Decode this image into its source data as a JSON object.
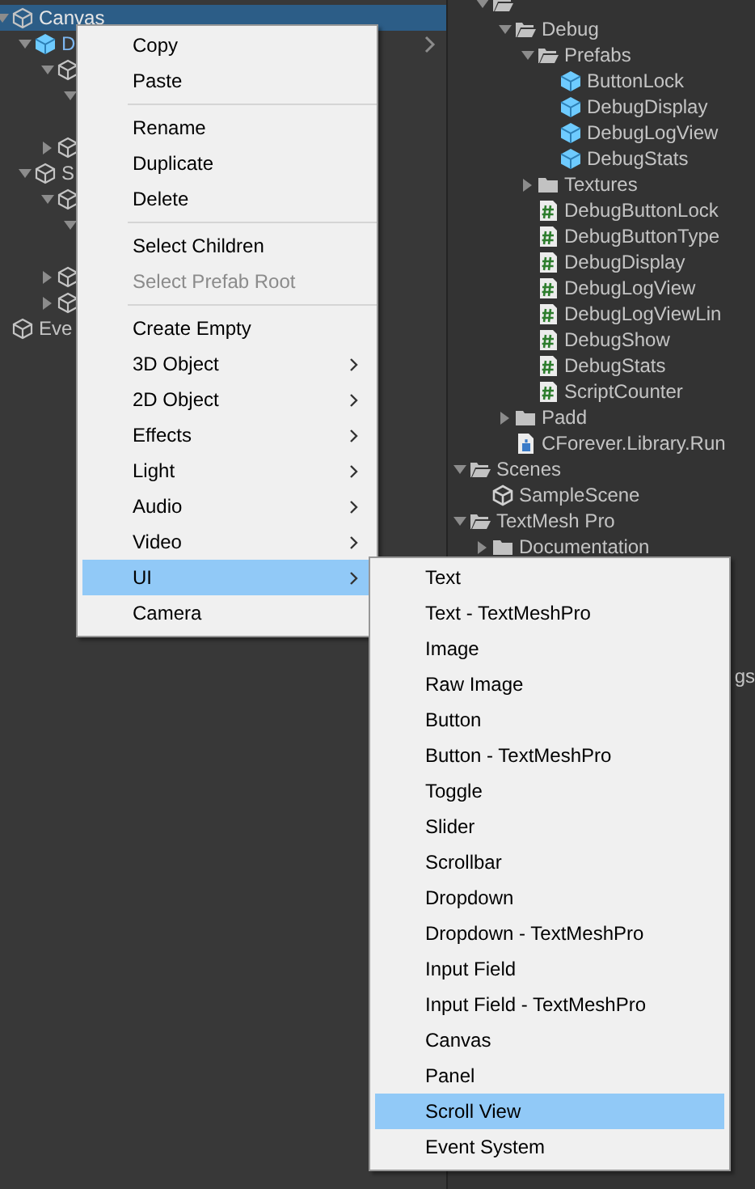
{
  "hierarchy": [
    {
      "label": "Canvas",
      "kind": "gameobject",
      "expanded": true,
      "selected": true,
      "children": [
        {
          "label": "D",
          "kind": "prefab",
          "expanded": true,
          "selected": false,
          "prefab_arrow": true,
          "children": [
            {
              "kind": "gameobject",
              "expanded": true,
              "selected": false,
              "children": [
                {
                  "expanded": true,
                  "selected": false
                }
              ]
            },
            {
              "kind": "gameobject",
              "expanded": false,
              "selected": false
            }
          ]
        },
        {
          "label": "S",
          "kind": "gameobject",
          "expanded": true,
          "selected": false,
          "children": [
            {
              "kind": "gameobject",
              "expanded": true,
              "selected": false,
              "children": [
                {
                  "expanded": true,
                  "selected": false
                }
              ]
            },
            {
              "kind": "gameobject",
              "expanded": false,
              "selected": false
            },
            {
              "kind": "gameobject",
              "expanded": false,
              "selected": false
            }
          ]
        }
      ]
    },
    {
      "label": "Eve",
      "kind": "gameobject",
      "selected": false
    }
  ],
  "project_tree": [
    {
      "kind": "partial",
      "children": [
        {
          "kind": "folder",
          "expanded": true,
          "children": [
            {
              "label": "Debug",
              "kind": "folder",
              "expanded": true,
              "children": [
                {
                  "label": "Prefabs",
                  "kind": "folder",
                  "expanded": true,
                  "children": [
                    {
                      "label": "ButtonLock",
                      "kind": "prefab"
                    },
                    {
                      "label": "DebugDisplay",
                      "kind": "prefab"
                    },
                    {
                      "label": "DebugLogView",
                      "kind": "prefab"
                    },
                    {
                      "label": "DebugStats",
                      "kind": "prefab"
                    }
                  ]
                },
                {
                  "label": "Textures",
                  "kind": "folder",
                  "expanded": false
                },
                {
                  "label": "DebugButtonLock",
                  "kind": "script"
                },
                {
                  "label": "DebugButtonType",
                  "kind": "script"
                },
                {
                  "label": "DebugDisplay",
                  "kind": "script"
                },
                {
                  "label": "DebugLogView",
                  "kind": "script"
                },
                {
                  "label": "DebugLogViewLin",
                  "kind": "script"
                },
                {
                  "label": "DebugShow",
                  "kind": "script"
                },
                {
                  "label": "DebugStats",
                  "kind": "script"
                },
                {
                  "label": "ScriptCounter",
                  "kind": "script"
                }
              ]
            },
            {
              "label": "Padd",
              "kind": "folder",
              "expanded": false
            },
            {
              "label": "CForever.Library.Run",
              "kind": "asset"
            }
          ]
        }
      ]
    },
    {
      "label": "Scenes",
      "kind": "folder",
      "expanded": true,
      "children": [
        {
          "label": "SampleScene",
          "kind": "scene"
        }
      ]
    },
    {
      "label": "TextMesh Pro",
      "kind": "folder",
      "expanded": true,
      "children": [
        {
          "label": "Documentation",
          "kind": "folder",
          "expanded": false
        },
        {
          "kind": "tail",
          "label": "gs"
        }
      ]
    }
  ],
  "context_menu": [
    {
      "kind": "item",
      "label": "Copy",
      "disabled": false,
      "submenu": false,
      "selected": false
    },
    {
      "kind": "item",
      "label": "Paste",
      "disabled": false,
      "submenu": false,
      "selected": false
    },
    {
      "kind": "separator"
    },
    {
      "kind": "item",
      "label": "Rename",
      "disabled": false,
      "submenu": false,
      "selected": false
    },
    {
      "kind": "item",
      "label": "Duplicate",
      "disabled": false,
      "submenu": false,
      "selected": false
    },
    {
      "kind": "item",
      "label": "Delete",
      "disabled": false,
      "submenu": false,
      "selected": false
    },
    {
      "kind": "separator"
    },
    {
      "kind": "item",
      "label": "Select Children",
      "disabled": false,
      "submenu": false,
      "selected": false
    },
    {
      "kind": "item",
      "label": "Select Prefab Root",
      "disabled": true,
      "submenu": false,
      "selected": false
    },
    {
      "kind": "separator"
    },
    {
      "kind": "item",
      "label": "Create Empty",
      "disabled": false,
      "submenu": false,
      "selected": false
    },
    {
      "kind": "item",
      "label": "3D Object",
      "disabled": false,
      "submenu": true,
      "selected": false
    },
    {
      "kind": "item",
      "label": "2D Object",
      "disabled": false,
      "submenu": true,
      "selected": false
    },
    {
      "kind": "item",
      "label": "Effects",
      "disabled": false,
      "submenu": true,
      "selected": false
    },
    {
      "kind": "item",
      "label": "Light",
      "disabled": false,
      "submenu": true,
      "selected": false
    },
    {
      "kind": "item",
      "label": "Audio",
      "disabled": false,
      "submenu": true,
      "selected": false
    },
    {
      "kind": "item",
      "label": "Video",
      "disabled": false,
      "submenu": true,
      "selected": false
    },
    {
      "kind": "item",
      "label": "UI",
      "disabled": false,
      "submenu": true,
      "selected": true
    },
    {
      "kind": "item",
      "label": "Camera",
      "disabled": false,
      "submenu": false,
      "selected": false
    }
  ],
  "ui_submenu": [
    {
      "label": "Text",
      "selected": false
    },
    {
      "label": "Text - TextMeshPro",
      "selected": false
    },
    {
      "label": "Image",
      "selected": false
    },
    {
      "label": "Raw Image",
      "selected": false
    },
    {
      "label": "Button",
      "selected": false
    },
    {
      "label": "Button - TextMeshPro",
      "selected": false
    },
    {
      "label": "Toggle",
      "selected": false
    },
    {
      "label": "Slider",
      "selected": false
    },
    {
      "label": "Scrollbar",
      "selected": false
    },
    {
      "label": "Dropdown",
      "selected": false
    },
    {
      "label": "Dropdown - TextMeshPro",
      "selected": false
    },
    {
      "label": "Input Field",
      "selected": false
    },
    {
      "label": "Input Field - TextMeshPro",
      "selected": false
    },
    {
      "label": "Canvas",
      "selected": false
    },
    {
      "label": "Panel",
      "selected": false
    },
    {
      "label": "Scroll View",
      "selected": true
    },
    {
      "label": "Event System",
      "selected": false
    }
  ]
}
